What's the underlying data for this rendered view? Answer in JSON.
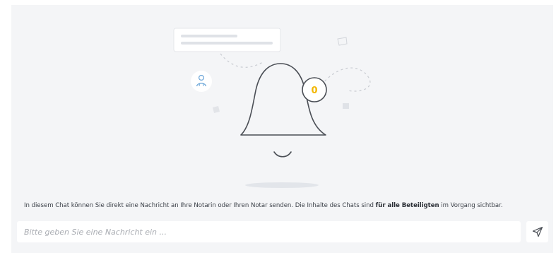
{
  "chat": {
    "notification_count": "0",
    "info_text_before": "In diesem Chat können Sie direkt eine Nachricht an Ihre Notarin oder Ihren Notar senden. Die Inhalte des Chats sind ",
    "info_text_bold": "für alle Beteiligten",
    "info_text_after": " im Vorgang sichtbar.",
    "input_placeholder": "Bitte geben Sie eine Nachricht ein ...",
    "input_value": ""
  },
  "icons": {
    "illustration": "bell-icon",
    "avatar": "person-icon",
    "send": "send-icon"
  },
  "colors": {
    "panel_background": "#f4f5f7",
    "badge_accent": "#f2b705",
    "avatar_accent": "#6aa5d8",
    "line_color": "#4a4e55"
  }
}
